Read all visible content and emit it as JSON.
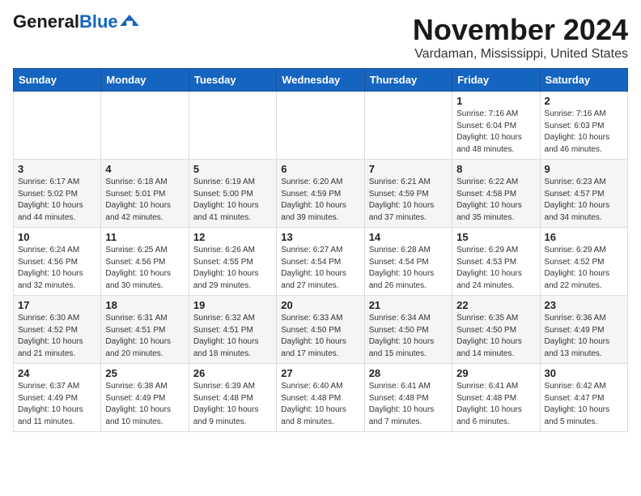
{
  "logo": {
    "text_general": "General",
    "text_blue": "Blue"
  },
  "title": "November 2024",
  "location": "Vardaman, Mississippi, United States",
  "days_of_week": [
    "Sunday",
    "Monday",
    "Tuesday",
    "Wednesday",
    "Thursday",
    "Friday",
    "Saturday"
  ],
  "weeks": [
    [
      {
        "day": "",
        "info": ""
      },
      {
        "day": "",
        "info": ""
      },
      {
        "day": "",
        "info": ""
      },
      {
        "day": "",
        "info": ""
      },
      {
        "day": "",
        "info": ""
      },
      {
        "day": "1",
        "info": "Sunrise: 7:16 AM\nSunset: 6:04 PM\nDaylight: 10 hours\nand 48 minutes."
      },
      {
        "day": "2",
        "info": "Sunrise: 7:16 AM\nSunset: 6:03 PM\nDaylight: 10 hours\nand 46 minutes."
      }
    ],
    [
      {
        "day": "3",
        "info": "Sunrise: 6:17 AM\nSunset: 5:02 PM\nDaylight: 10 hours\nand 44 minutes."
      },
      {
        "day": "4",
        "info": "Sunrise: 6:18 AM\nSunset: 5:01 PM\nDaylight: 10 hours\nand 42 minutes."
      },
      {
        "day": "5",
        "info": "Sunrise: 6:19 AM\nSunset: 5:00 PM\nDaylight: 10 hours\nand 41 minutes."
      },
      {
        "day": "6",
        "info": "Sunrise: 6:20 AM\nSunset: 4:59 PM\nDaylight: 10 hours\nand 39 minutes."
      },
      {
        "day": "7",
        "info": "Sunrise: 6:21 AM\nSunset: 4:59 PM\nDaylight: 10 hours\nand 37 minutes."
      },
      {
        "day": "8",
        "info": "Sunrise: 6:22 AM\nSunset: 4:58 PM\nDaylight: 10 hours\nand 35 minutes."
      },
      {
        "day": "9",
        "info": "Sunrise: 6:23 AM\nSunset: 4:57 PM\nDaylight: 10 hours\nand 34 minutes."
      }
    ],
    [
      {
        "day": "10",
        "info": "Sunrise: 6:24 AM\nSunset: 4:56 PM\nDaylight: 10 hours\nand 32 minutes."
      },
      {
        "day": "11",
        "info": "Sunrise: 6:25 AM\nSunset: 4:56 PM\nDaylight: 10 hours\nand 30 minutes."
      },
      {
        "day": "12",
        "info": "Sunrise: 6:26 AM\nSunset: 4:55 PM\nDaylight: 10 hours\nand 29 minutes."
      },
      {
        "day": "13",
        "info": "Sunrise: 6:27 AM\nSunset: 4:54 PM\nDaylight: 10 hours\nand 27 minutes."
      },
      {
        "day": "14",
        "info": "Sunrise: 6:28 AM\nSunset: 4:54 PM\nDaylight: 10 hours\nand 26 minutes."
      },
      {
        "day": "15",
        "info": "Sunrise: 6:29 AM\nSunset: 4:53 PM\nDaylight: 10 hours\nand 24 minutes."
      },
      {
        "day": "16",
        "info": "Sunrise: 6:29 AM\nSunset: 4:52 PM\nDaylight: 10 hours\nand 22 minutes."
      }
    ],
    [
      {
        "day": "17",
        "info": "Sunrise: 6:30 AM\nSunset: 4:52 PM\nDaylight: 10 hours\nand 21 minutes."
      },
      {
        "day": "18",
        "info": "Sunrise: 6:31 AM\nSunset: 4:51 PM\nDaylight: 10 hours\nand 20 minutes."
      },
      {
        "day": "19",
        "info": "Sunrise: 6:32 AM\nSunset: 4:51 PM\nDaylight: 10 hours\nand 18 minutes."
      },
      {
        "day": "20",
        "info": "Sunrise: 6:33 AM\nSunset: 4:50 PM\nDaylight: 10 hours\nand 17 minutes."
      },
      {
        "day": "21",
        "info": "Sunrise: 6:34 AM\nSunset: 4:50 PM\nDaylight: 10 hours\nand 15 minutes."
      },
      {
        "day": "22",
        "info": "Sunrise: 6:35 AM\nSunset: 4:50 PM\nDaylight: 10 hours\nand 14 minutes."
      },
      {
        "day": "23",
        "info": "Sunrise: 6:36 AM\nSunset: 4:49 PM\nDaylight: 10 hours\nand 13 minutes."
      }
    ],
    [
      {
        "day": "24",
        "info": "Sunrise: 6:37 AM\nSunset: 4:49 PM\nDaylight: 10 hours\nand 11 minutes."
      },
      {
        "day": "25",
        "info": "Sunrise: 6:38 AM\nSunset: 4:49 PM\nDaylight: 10 hours\nand 10 minutes."
      },
      {
        "day": "26",
        "info": "Sunrise: 6:39 AM\nSunset: 4:48 PM\nDaylight: 10 hours\nand 9 minutes."
      },
      {
        "day": "27",
        "info": "Sunrise: 6:40 AM\nSunset: 4:48 PM\nDaylight: 10 hours\nand 8 minutes."
      },
      {
        "day": "28",
        "info": "Sunrise: 6:41 AM\nSunset: 4:48 PM\nDaylight: 10 hours\nand 7 minutes."
      },
      {
        "day": "29",
        "info": "Sunrise: 6:41 AM\nSunset: 4:48 PM\nDaylight: 10 hours\nand 6 minutes."
      },
      {
        "day": "30",
        "info": "Sunrise: 6:42 AM\nSunset: 4:47 PM\nDaylight: 10 hours\nand 5 minutes."
      }
    ]
  ]
}
